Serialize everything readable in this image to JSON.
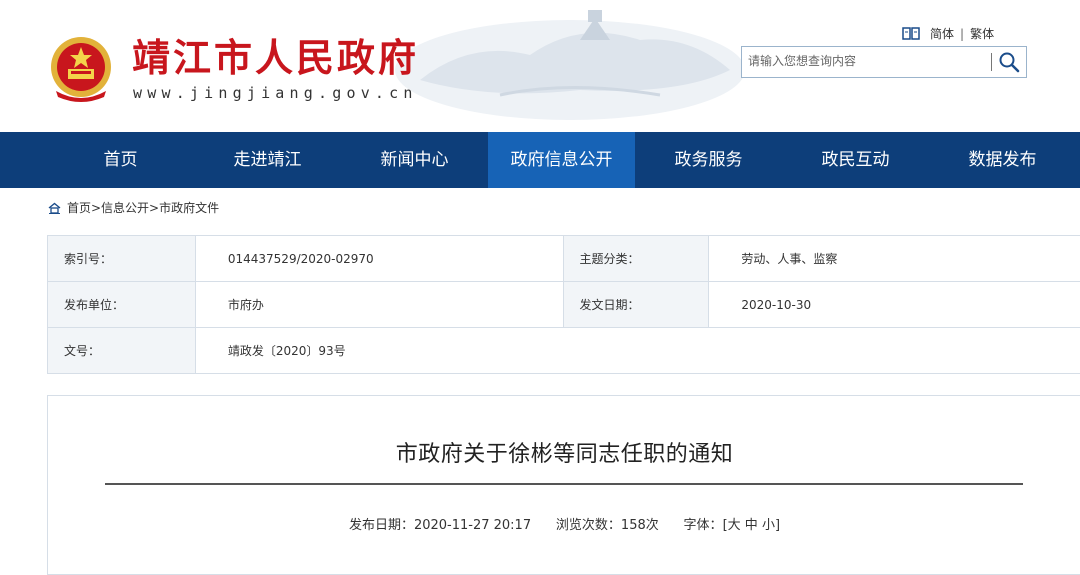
{
  "header": {
    "site_title": "靖江市人民政府",
    "site_url": "www.jingjiang.gov.cn",
    "lang_simplified": "简体",
    "lang_sep": "|",
    "lang_traditional": "繁体",
    "search_placeholder": "请输入您想查询内容",
    "brand_color": "#c8161d"
  },
  "nav": {
    "items": [
      {
        "label": "首页"
      },
      {
        "label": "走进靖江"
      },
      {
        "label": "新闻中心"
      },
      {
        "label": "政府信息公开"
      },
      {
        "label": "政务服务"
      },
      {
        "label": "政民互动"
      },
      {
        "label": "数据发布"
      }
    ],
    "active_index": 3,
    "bg_color": "#0d3e7a",
    "active_color": "#1763b6"
  },
  "breadcrumb": {
    "text": "首页>信息公开>市政府文件"
  },
  "info": {
    "index_label": "索引号：",
    "index_value": "014437529/2020-02970",
    "topic_label": "主题分类：",
    "topic_value": "劳动、人事、监察",
    "issuer_label": "发布单位：",
    "issuer_value": "市府办",
    "date_label": "发文日期：",
    "date_value": "2020-10-30",
    "docno_label": "文号：",
    "docno_value": "靖政发〔2020〕93号"
  },
  "article": {
    "title": "市政府关于徐彬等同志任职的通知",
    "published_label": "发布日期：",
    "published_value": "2020-11-27 20:17",
    "views_label": "浏览次数：",
    "views_value": "158次",
    "font_label": "字体：",
    "font_open": "[",
    "font_large": "大",
    "font_medium": "中",
    "font_small": "小",
    "font_close": "]"
  }
}
